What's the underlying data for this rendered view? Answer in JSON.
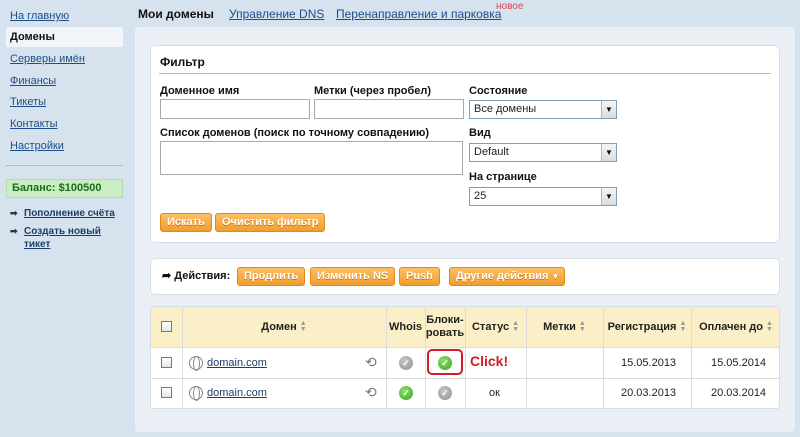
{
  "sidebar": {
    "items": [
      {
        "label": "На главную"
      },
      {
        "label": "Домены"
      },
      {
        "label": "Серверы имён"
      },
      {
        "label": "Финансы"
      },
      {
        "label": "Тикеты"
      },
      {
        "label": "Контакты"
      },
      {
        "label": "Настройки"
      }
    ],
    "balance": "Баланс:   $100500",
    "links": [
      {
        "label": "Пополнение счёта"
      },
      {
        "label": "Создать новый тикет"
      }
    ]
  },
  "tabs": [
    {
      "label": "Мои домены"
    },
    {
      "label": "Управление DNS"
    },
    {
      "label": "Перенаправление и парковка"
    }
  ],
  "new_badge": "новое",
  "filter": {
    "title": "Фильтр",
    "domain_label": "Доменное имя",
    "domain_value": "",
    "tags_label": "Метки (через пробел)",
    "tags_value": "",
    "state_label": "Состояние",
    "state_value": "Все домены",
    "list_label": "Список доменов (поиск по точному совпадению)",
    "list_value": "",
    "view_label": "Вид",
    "view_value": "Default",
    "per_page_label": "На странице",
    "per_page_value": "25",
    "search_button": "Искать",
    "clear_button": "Очистить фильтр"
  },
  "actions": {
    "label": "Действия:",
    "buttons": [
      "Продлить",
      "Изменить NS",
      "Push",
      "Другие действия"
    ]
  },
  "table": {
    "headers": {
      "domain": "Домен",
      "whois": "Whois",
      "block_1": "Блоки-",
      "block_2": "ровать",
      "status": "Статус",
      "tags": "Метки",
      "registration": "Регистрация",
      "paid_until": "Оплачен до"
    },
    "rows": [
      {
        "domain": "domain.com",
        "whois": "gray",
        "block": "green",
        "status": "",
        "tags": "",
        "registration": "15.05.2013",
        "paid_until": "15.05.2014"
      },
      {
        "domain": "domain.com",
        "whois": "green",
        "block": "gray",
        "status": "ок",
        "tags": "",
        "registration": "20.03.2013",
        "paid_until": "20.03.2014"
      }
    ]
  },
  "annotation": {
    "click_label": "Click!"
  },
  "colors": {
    "accent_orange": "#f29d2c",
    "link_blue": "#1d4e86",
    "highlight_red": "#d31c24",
    "balance_green": "#1d6b16"
  }
}
